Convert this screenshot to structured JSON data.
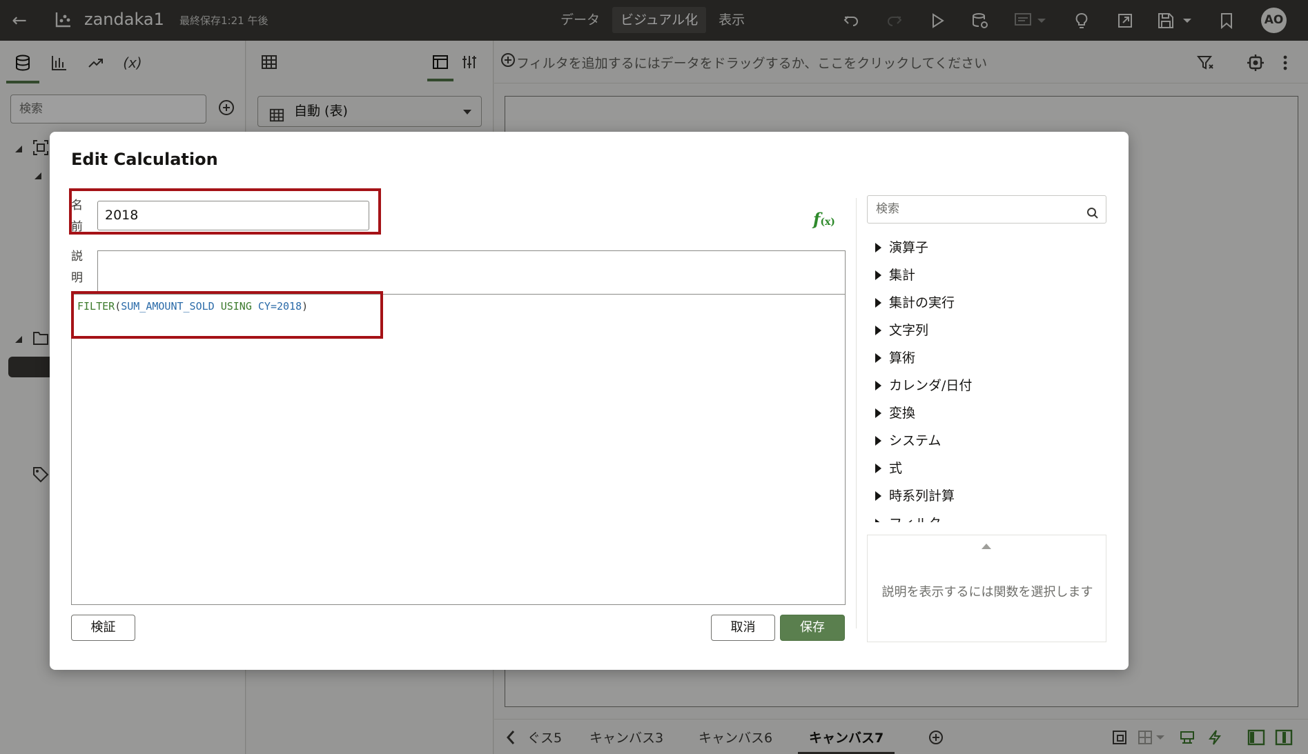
{
  "topbar": {
    "project_title": "zandaka1",
    "saved_status": "最終保存1:21 午後",
    "modes": [
      "データ",
      "ビジュアル化",
      "表示"
    ],
    "active_mode": "ビジュアル化",
    "avatar_initials": "AO"
  },
  "data_panel": {
    "search_placeholder": "検索"
  },
  "grammar_panel": {
    "viz_type": "自動 (表)"
  },
  "canvas": {
    "filter_hint": "フィルタを追加するにはデータをドラッグするか、ここをクリックしてください",
    "tabs": [
      "ぐス5",
      "キャンバス3",
      "キャンバス6",
      "キャンバス7"
    ],
    "active_tab": "キャンバス7"
  },
  "dialog": {
    "title": "Edit Calculation",
    "name_label": "名前",
    "name_value": "2018",
    "description_label": "説明",
    "description_value": "",
    "expression": {
      "func": "FILTER",
      "open": "(",
      "column": "SUM_AMOUNT_SOLD",
      "keyword": " USING ",
      "condition": "CY=2018",
      "close": ")"
    },
    "fx_label": "f",
    "fx_sub": "(x)",
    "validate_label": "検証",
    "cancel_label": "取消",
    "save_label": "保存",
    "function_search_placeholder": "検索",
    "function_categories": [
      "演算子",
      "集計",
      "集計の実行",
      "文字列",
      "算術",
      "カレンダ/日付",
      "変換",
      "システム",
      "式",
      "時系列計算",
      "フィルタ"
    ],
    "function_description_hint": "説明を表示するには関数を選択します"
  },
  "colors": {
    "topbar_bg": "#3a3936",
    "accent_green": "#5a7f4e",
    "highlight_red": "#a51217",
    "keyword_green": "#3c7a2c",
    "column_blue": "#2a6aa8"
  }
}
